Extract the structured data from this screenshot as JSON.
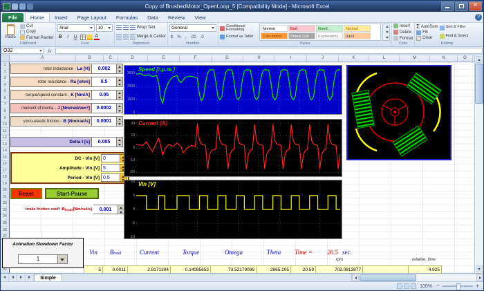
{
  "window": {
    "title": "Copy of BrushedMotor_OpenLoop_5 [Compatibility Mode]  -  Microsoft Excel"
  },
  "ribbon": {
    "tabs": [
      "File",
      "Home",
      "Insert",
      "Page Layout",
      "Formulas",
      "Data",
      "Review",
      "View"
    ],
    "active_tab": "Home",
    "groups": [
      "Clipboard",
      "Font",
      "Alignment",
      "Number",
      "Styles",
      "Cells",
      "Editing"
    ],
    "clipboard": {
      "paste": "Paste",
      "cut": "Cut",
      "copy": "Copy",
      "format_painter": "Format Painter"
    },
    "font": {
      "name": "Arial",
      "size": "10",
      "bold": "B",
      "italic": "I",
      "underline": "U",
      "color_letter": "A"
    },
    "alignment": {
      "wrap": "Wrap Text",
      "merge": "Merge & Center"
    },
    "number": {
      "format": "General",
      "icons": [
        "$",
        "%",
        ",",
        ".00",
        ".0"
      ]
    },
    "styles": {
      "conditional": "Conditional Formatting",
      "as_table": "Format as Table",
      "cell_styles": [
        {
          "label": "Normal",
          "bg": "#ffffff",
          "fg": "#000000"
        },
        {
          "label": "Bad",
          "bg": "#ffc7ce",
          "fg": "#9c0006"
        },
        {
          "label": "Good",
          "bg": "#c6efce",
          "fg": "#006100"
        },
        {
          "label": "Neutral",
          "bg": "#ffeb9c",
          "fg": "#9c6500"
        },
        {
          "label": "Calculation",
          "bg": "#ff9933",
          "fg": "#7f3f00"
        },
        {
          "label": "Check Cell",
          "bg": "#a5a5a5",
          "fg": "#ffffff"
        },
        {
          "label": "Explanatory ...",
          "bg": "#ffffff",
          "fg": "#7f7f7f"
        },
        {
          "label": "Input",
          "bg": "#ffcc99",
          "fg": "#3f3f76"
        }
      ]
    },
    "cells": [
      "Insert",
      "Delete",
      "Format"
    ],
    "editing": {
      "sigma": "Σ",
      "autosum": "AutoSum",
      "fill": "Fill",
      "clear": "Clear",
      "sort": "Sort & Filter",
      "find": "Find & Select"
    }
  },
  "formula_bar": {
    "name_box": "O32",
    "fx": "fx",
    "content": ""
  },
  "columns": [
    "A",
    "B",
    "C",
    "D",
    "E",
    "F",
    "G",
    "H",
    "I",
    "J",
    "K",
    "L",
    "M",
    "N",
    "O"
  ],
  "rows": 32,
  "parameters": [
    {
      "prefix": "rotor inductance - ",
      "symbol": "La [H]",
      "value": "0.002",
      "bg": "#f6dcc4"
    },
    {
      "prefix": "rotor resistance - ",
      "symbol": "Ra [ohm]",
      "value": "0.5",
      "bg": "#f6dcc4"
    },
    {
      "prefix": "torque/speed constant - ",
      "symbol": "K [Nm/A]",
      "value": "0.05",
      "bg": "#f6dcc4"
    },
    {
      "prefix": "moment of inertia - ",
      "symbol": "J [Nm/rad/sec²]",
      "value": "0.0002",
      "bg": "#f2c0bd"
    },
    {
      "prefix": "visco-elastic friction - ",
      "symbol": "B [Nm/rad/s]",
      "value": "0.0001",
      "bg": "#eedcc8"
    },
    {
      "prefix": "",
      "symbol": "Delta t [s]",
      "value": "0.005",
      "bg": "#c9bfe4"
    }
  ],
  "vin_group": {
    "rows": [
      {
        "label": "DC - Vin [V]",
        "value": "0"
      },
      {
        "label": "Amplitude - Vin [V]",
        "value": "5"
      },
      {
        "label": "Period - Vin [V]",
        "value": "0.5"
      }
    ]
  },
  "buttons": {
    "reset": "Reset",
    "start_pause": "Start-Pause"
  },
  "brake": {
    "prefix": "brake friction coeff - ",
    "symbol": "B",
    "sub": "brake",
    "unit": " [Nm/rad/s]",
    "value": "0.001"
  },
  "animation": {
    "label": "Animation Slowdown Factor",
    "value": "1"
  },
  "summary": {
    "labels": [
      "Vin",
      "B",
      "Current",
      "Torque",
      "Omega",
      "Theta"
    ],
    "b_sub": "total",
    "time_label": "Time =",
    "time_value": "20.5",
    "time_unit": "sec.",
    "rpm_label": "rpm",
    "relative_time_label": "relative_time",
    "values": [
      "5",
      "0.0011",
      "2.8171304",
      "0.14085652",
      "73.52179099",
      "2965.105",
      "20.59",
      "702.0813877",
      "",
      "4.925"
    ]
  },
  "sheet": {
    "tab": "Simple",
    "zoom": "100%"
  },
  "chart_data": [
    {
      "type": "line",
      "title": "Speed [r.p.m.]",
      "series_color": "#00ee00",
      "bg": "#0000c8",
      "grid_color": "#4444ee",
      "ymin": 0,
      "ymax": 3500,
      "yticks": [
        3000,
        2000,
        1000,
        0
      ],
      "points": [
        [
          0,
          2950
        ],
        [
          2,
          3000
        ],
        [
          4,
          2850
        ],
        [
          6,
          2900
        ],
        [
          8,
          2780
        ],
        [
          10,
          2850
        ],
        [
          11,
          2300
        ],
        [
          12,
          1100
        ],
        [
          13,
          700
        ],
        [
          14,
          1600
        ],
        [
          16,
          2400
        ],
        [
          18,
          2750
        ],
        [
          20,
          2850
        ],
        [
          21,
          2450
        ],
        [
          22,
          2300
        ],
        [
          24,
          2700
        ],
        [
          26,
          2800
        ],
        [
          28,
          2760
        ],
        [
          30,
          2650
        ],
        [
          31,
          1400
        ],
        [
          32,
          900
        ],
        [
          33,
          1200
        ],
        [
          34,
          2300
        ],
        [
          35,
          3050
        ],
        [
          36,
          3280
        ],
        [
          38,
          3300
        ],
        [
          39,
          2400
        ],
        [
          40,
          1250
        ],
        [
          41,
          980
        ],
        [
          42,
          1250
        ],
        [
          43,
          2450
        ],
        [
          44,
          3150
        ],
        [
          45,
          3300
        ],
        [
          47,
          3260
        ],
        [
          48,
          2350
        ],
        [
          49,
          1220
        ],
        [
          50,
          980
        ],
        [
          51,
          1250
        ],
        [
          52,
          2500
        ],
        [
          53,
          3180
        ],
        [
          54,
          3300
        ],
        [
          56,
          3260
        ],
        [
          57,
          2350
        ],
        [
          58,
          1220
        ],
        [
          59,
          980
        ],
        [
          60,
          1250
        ],
        [
          61,
          2500
        ],
        [
          62,
          3180
        ],
        [
          63,
          3300
        ],
        [
          65,
          3260
        ],
        [
          66,
          2350
        ],
        [
          67,
          1220
        ],
        [
          68,
          980
        ],
        [
          69,
          1250
        ],
        [
          70,
          2500
        ],
        [
          71,
          3180
        ],
        [
          72,
          3300
        ],
        [
          74,
          3260
        ],
        [
          75,
          2350
        ],
        [
          76,
          1220
        ],
        [
          77,
          980
        ],
        [
          78,
          1250
        ],
        [
          79,
          2500
        ],
        [
          80,
          3180
        ],
        [
          81,
          3300
        ],
        [
          83,
          3260
        ],
        [
          84,
          2350
        ],
        [
          85,
          1220
        ],
        [
          86,
          980
        ],
        [
          87,
          1250
        ],
        [
          88,
          2500
        ],
        [
          89,
          3180
        ],
        [
          90,
          3300
        ],
        [
          92,
          3260
        ],
        [
          93,
          2350
        ],
        [
          94,
          1220
        ],
        [
          95,
          980
        ],
        [
          96,
          1250
        ],
        [
          97,
          2500
        ],
        [
          98,
          3180
        ],
        [
          99,
          3300
        ],
        [
          100,
          3280
        ]
      ]
    },
    {
      "type": "line",
      "title": "Current (A)",
      "series_color": "#ff2020",
      "bg": "#000000",
      "grid_color": "#3a3a3a",
      "ymin": -22,
      "ymax": 22,
      "yticks": [
        20,
        10,
        0,
        -10,
        -20
      ],
      "points": [
        [
          0,
          3
        ],
        [
          3,
          2
        ],
        [
          5,
          5
        ],
        [
          6,
          2
        ],
        [
          8,
          -3
        ],
        [
          9,
          1
        ],
        [
          11,
          8
        ],
        [
          12,
          2
        ],
        [
          13,
          -6
        ],
        [
          14,
          -1
        ],
        [
          16,
          3
        ],
        [
          18,
          1
        ],
        [
          20,
          4
        ],
        [
          22,
          1
        ],
        [
          23,
          -4
        ],
        [
          25,
          0
        ],
        [
          27,
          2
        ],
        [
          29,
          1
        ],
        [
          30,
          20
        ],
        [
          31,
          6
        ],
        [
          32,
          3
        ],
        [
          34,
          2
        ],
        [
          35,
          -17
        ],
        [
          36,
          -5
        ],
        [
          37,
          -2
        ],
        [
          39,
          -1
        ],
        [
          40,
          19
        ],
        [
          41,
          6
        ],
        [
          42,
          3
        ],
        [
          44,
          2
        ],
        [
          45,
          -17
        ],
        [
          46,
          -5
        ],
        [
          47,
          -2
        ],
        [
          48,
          -1
        ],
        [
          49,
          19
        ],
        [
          50,
          6
        ],
        [
          51,
          3
        ],
        [
          53,
          2
        ],
        [
          54,
          -17
        ],
        [
          55,
          -5
        ],
        [
          56,
          -2
        ],
        [
          57,
          -1
        ],
        [
          58,
          19
        ],
        [
          59,
          6
        ],
        [
          60,
          3
        ],
        [
          62,
          2
        ],
        [
          63,
          -17
        ],
        [
          64,
          -5
        ],
        [
          65,
          -2
        ],
        [
          66,
          -1
        ],
        [
          67,
          19
        ],
        [
          68,
          6
        ],
        [
          69,
          3
        ],
        [
          71,
          2
        ],
        [
          72,
          -17
        ],
        [
          73,
          -5
        ],
        [
          74,
          -2
        ],
        [
          75,
          -1
        ],
        [
          76,
          19
        ],
        [
          77,
          6
        ],
        [
          78,
          3
        ],
        [
          80,
          2
        ],
        [
          81,
          -17
        ],
        [
          82,
          -5
        ],
        [
          83,
          -2
        ],
        [
          84,
          -1
        ],
        [
          85,
          19
        ],
        [
          86,
          6
        ],
        [
          87,
          3
        ],
        [
          89,
          2
        ],
        [
          90,
          -17
        ],
        [
          91,
          -5
        ],
        [
          92,
          -2
        ],
        [
          93,
          -1
        ],
        [
          94,
          19
        ],
        [
          95,
          6
        ],
        [
          96,
          3
        ],
        [
          98,
          2
        ],
        [
          99,
          -17
        ],
        [
          100,
          -5
        ]
      ]
    },
    {
      "type": "line",
      "title": "Vin [V]",
      "series_color": "#ffff00",
      "bg": "#000000",
      "grid_color": "#3a3a3a",
      "ymin": -10,
      "ymax": 10,
      "yticks": [
        10,
        5,
        0,
        -5,
        -10
      ],
      "points": [
        [
          0,
          5
        ],
        [
          5,
          5
        ],
        [
          5,
          0
        ],
        [
          11,
          0
        ],
        [
          11,
          5
        ],
        [
          14,
          5
        ],
        [
          14,
          0
        ],
        [
          20,
          0
        ],
        [
          20,
          5
        ],
        [
          26,
          5
        ],
        [
          26,
          0
        ],
        [
          31,
          0
        ],
        [
          31,
          5
        ],
        [
          35,
          5
        ],
        [
          35,
          0
        ],
        [
          40,
          0
        ],
        [
          40,
          5
        ],
        [
          44,
          5
        ],
        [
          44,
          0
        ],
        [
          49,
          0
        ],
        [
          49,
          5
        ],
        [
          53,
          5
        ],
        [
          53,
          0
        ],
        [
          58,
          0
        ],
        [
          58,
          5
        ],
        [
          62,
          5
        ],
        [
          62,
          0
        ],
        [
          67,
          0
        ],
        [
          67,
          5
        ],
        [
          71,
          5
        ],
        [
          71,
          0
        ],
        [
          76,
          0
        ],
        [
          76,
          5
        ],
        [
          80,
          5
        ],
        [
          80,
          0
        ],
        [
          85,
          0
        ],
        [
          85,
          5
        ],
        [
          89,
          5
        ],
        [
          89,
          0
        ],
        [
          94,
          0
        ],
        [
          94,
          5
        ],
        [
          98,
          5
        ],
        [
          98,
          0
        ],
        [
          100,
          0
        ]
      ]
    }
  ]
}
